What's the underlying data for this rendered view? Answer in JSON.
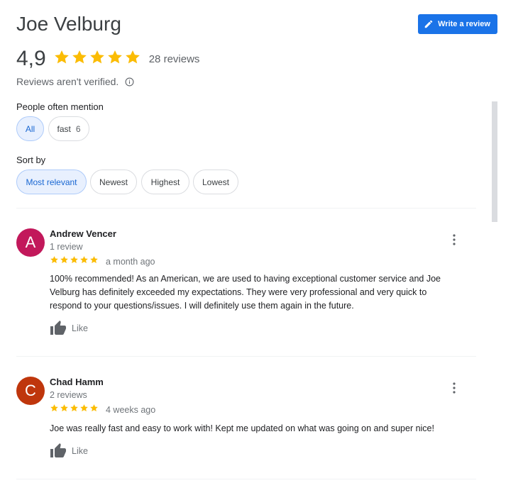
{
  "business_name": "Joe Velburg",
  "write_review_label": "Write a review",
  "rating": "4,9",
  "rating_stars": 5,
  "total_reviews": "28 reviews",
  "verified_note": "Reviews aren't verified.",
  "mentions": {
    "label": "People often mention",
    "chips": [
      {
        "label": "All",
        "count": "",
        "selected": true
      },
      {
        "label": "fast",
        "count": "6",
        "selected": false
      }
    ]
  },
  "sort": {
    "label": "Sort by",
    "options": [
      {
        "label": "Most relevant",
        "selected": true
      },
      {
        "label": "Newest",
        "selected": false
      },
      {
        "label": "Highest",
        "selected": false
      },
      {
        "label": "Lowest",
        "selected": false
      }
    ]
  },
  "reviews": [
    {
      "initial": "A",
      "avatar_color": "#c2185b",
      "author": "Andrew Vencer",
      "author_reviews": "1 review",
      "stars": 5,
      "when": "a month ago",
      "text_lines": [
        "100% recommended! As an American, we are used to having exceptional customer service and Joe",
        "Velburg has definitely exceeded my expectations. They were very professional and very quick to",
        "respond to your questions/issues. I will definitely use them again in the future."
      ],
      "like_label": "Like"
    },
    {
      "initial": "C",
      "avatar_color": "#bf360c",
      "author": "Chad Hamm",
      "author_reviews": "2 reviews",
      "stars": 5,
      "when": "4 weeks ago",
      "text_lines": [
        "Joe was really fast and easy to work with! Kept me updated on what was going on and super nice!"
      ],
      "like_label": "Like"
    }
  ],
  "colors": {
    "accent": "#1a73e8",
    "star": "#fbbc04"
  }
}
